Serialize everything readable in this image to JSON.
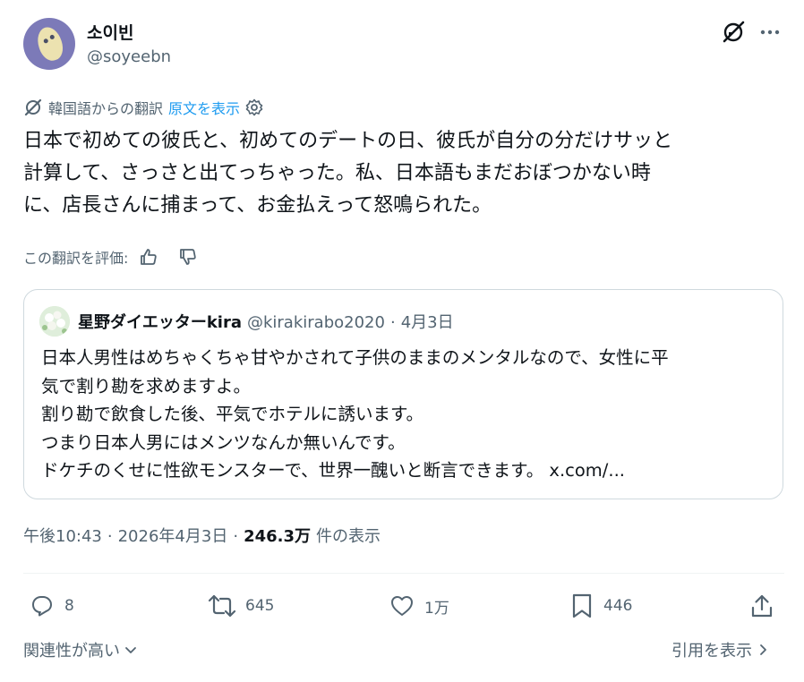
{
  "author": {
    "display_name": "소이빈",
    "handle": "@soyeebn"
  },
  "translation": {
    "label": "韓国語からの翻訳",
    "show_original": "原文を表示"
  },
  "tweet": {
    "lines": [
      "日本で初めての彼氏と、初めてのデートの日、彼氏が自分の分だけサッと",
      "計算して、さっさと出てっちゃった。私、日本語もまだおぼつかない時",
      "に、店長さんに捕まって、お金払えって怒鳴られた。"
    ]
  },
  "rating": {
    "label": "この翻訳を評価:"
  },
  "quote": {
    "name": "星野ダイエッターkira",
    "handle": "@kirakirabo2020",
    "separator": "·",
    "date": "4月3日",
    "lines": [
      "日本人男性はめちゃくちゃ甘やかされて子供のままのメンタルなので、女性に平",
      "気で割り勘を求めますよ。",
      "割り勘で飲食した後、平気でホテルに誘います。",
      "つまり日本人男にはメンツなんか無いんです。",
      "ドケチのくせに性欲モンスターで、世界一醜いと断言できます。 x.com/..."
    ]
  },
  "meta": {
    "time": "午後10:43",
    "sep1": "·",
    "date": "2026年4月3日",
    "sep2": "·",
    "views": "246.3万",
    "views_label": "件の表示"
  },
  "actions": {
    "replies": "8",
    "reposts": "645",
    "likes": "1万",
    "bookmarks": "446"
  },
  "footer": {
    "sort_label": "関連性が高い",
    "quotes_label": "引用を表示"
  },
  "icons": [
    "grok-icon",
    "more-icon",
    "translate-icon",
    "settings-icon",
    "thumbs-up-icon",
    "thumbs-down-icon",
    "reply-icon",
    "repost-icon",
    "like-icon",
    "bookmark-icon",
    "share-icon",
    "chevron-down-icon",
    "chevron-right-icon"
  ],
  "colors": {
    "text": "#0f1419",
    "secondary": "#536471",
    "link": "#1d9bf0",
    "border": "#cfd9de",
    "divider": "#eff3f4"
  }
}
